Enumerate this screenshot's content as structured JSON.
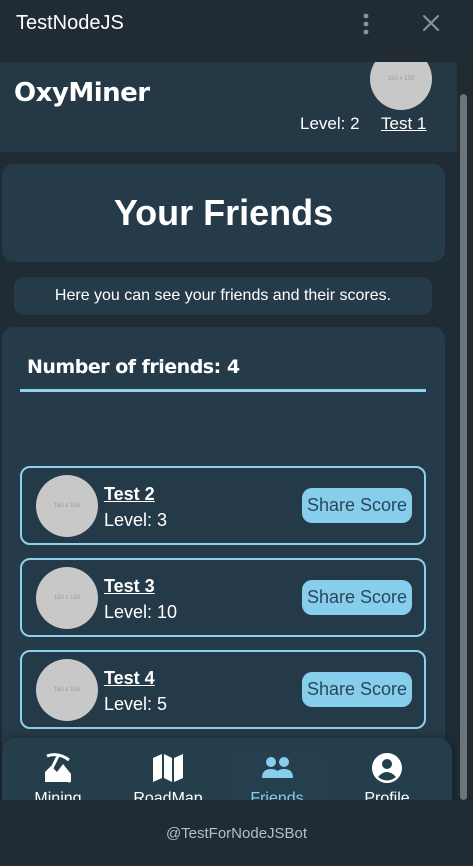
{
  "window": {
    "title": "TestNodeJS"
  },
  "header": {
    "brand": "OxyMiner",
    "avatar_placeholder": "150 x 150",
    "level_text": "Level: 2",
    "username": "Test 1"
  },
  "page": {
    "title": "Your Friends",
    "subtitle": "Here you can see your friends and their scores."
  },
  "friends": {
    "count_label": "Number of friends: 4",
    "share_label": "Share Score",
    "items": [
      {
        "name": "Test 2",
        "level": "Level: 3",
        "avatar_placeholder": "150 x 150"
      },
      {
        "name": "Test 3",
        "level": "Level: 10",
        "avatar_placeholder": "150 x 150"
      },
      {
        "name": "Test 4",
        "level": "Level: 5",
        "avatar_placeholder": "150 x 150"
      }
    ]
  },
  "nav": {
    "items": [
      {
        "label": "Mining",
        "icon": "mining-icon"
      },
      {
        "label": "RoadMap",
        "icon": "map-icon"
      },
      {
        "label": "Friends",
        "icon": "users-icon",
        "active": true
      },
      {
        "label": "Profile",
        "icon": "user-circle-icon"
      }
    ]
  },
  "footer": {
    "bot_handle": "@TestForNodeJSBot"
  },
  "colors": {
    "background": "#212b33",
    "card": "#263b49",
    "accent": "#87ceec",
    "header": "#253845"
  }
}
